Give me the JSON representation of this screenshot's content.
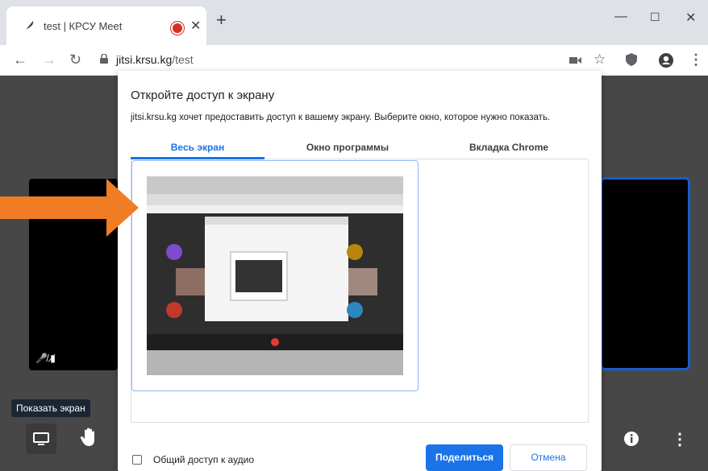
{
  "browser": {
    "tab_title": "test | КРСУ Meet",
    "url_domain": "jitsi.krsu.kg",
    "url_path": "/test"
  },
  "meet": {
    "tooltip": "Показать экран"
  },
  "dialog": {
    "title": "Откройте доступ к экрану",
    "subtitle": "jitsi.krsu.kg хочет предоставить доступ к вашему экрану. Выберите окно, которое нужно показать.",
    "tabs": [
      {
        "label": "Весь экран",
        "active": true
      },
      {
        "label": "Окно программы",
        "active": false
      },
      {
        "label": "Вкладка Chrome",
        "active": false
      }
    ],
    "audio_checkbox_label": "Общий доступ к аудио",
    "audio_checked": false,
    "share_label": "Поделиться",
    "cancel_label": "Отмена"
  },
  "colors": {
    "accent": "#1a73e8",
    "arrow": "#f07c24",
    "record": "#d93025"
  }
}
